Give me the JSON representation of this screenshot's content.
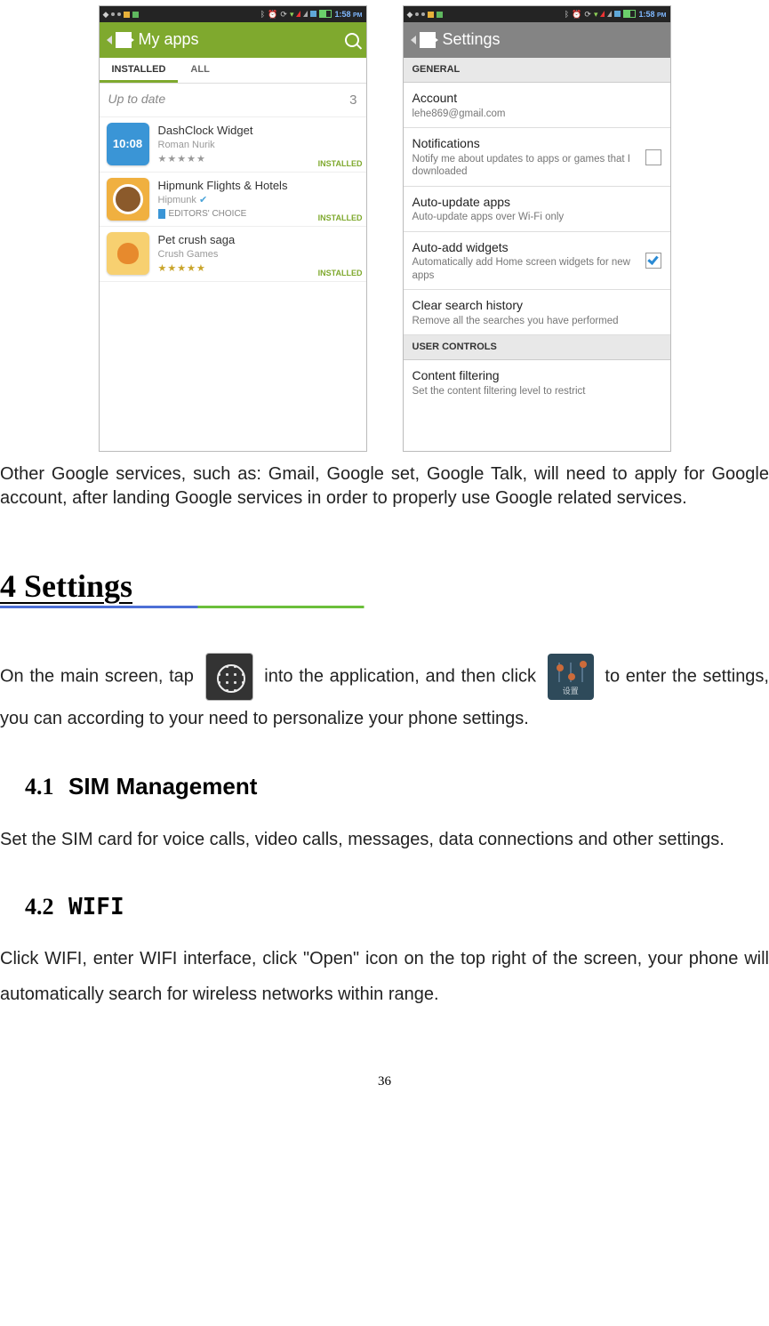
{
  "status": {
    "time": "1:58",
    "ampm": "PM"
  },
  "play": {
    "title": "My apps",
    "tabs": {
      "installed": "INSTALLED",
      "all": "ALL"
    },
    "uptodate": {
      "label": "Up to date",
      "count": "3"
    },
    "installed_badge": "INSTALLED",
    "apps": [
      {
        "name": "DashClock Widget",
        "dev": "Roman Nurik",
        "stars": "★★★★★",
        "iconTime": "10:08"
      },
      {
        "name": "Hipmunk Flights & Hotels",
        "dev": "Hipmunk",
        "editors": "EDITORS' CHOICE"
      },
      {
        "name": "Pet crush saga",
        "dev": "Crush Games",
        "stars": "★★★★★"
      }
    ]
  },
  "settings": {
    "title": "Settings",
    "section_general": "GENERAL",
    "items": {
      "account": {
        "title": "Account",
        "sub": "lehe869@gmail.com"
      },
      "notifications": {
        "title": "Notifications",
        "sub": "Notify me about updates to apps or games that I downloaded"
      },
      "autoupdate": {
        "title": "Auto-update apps",
        "sub": "Auto-update apps over Wi-Fi only"
      },
      "autoadd": {
        "title": "Auto-add widgets",
        "sub": "Automatically add Home screen widgets for new apps"
      },
      "clear": {
        "title": "Clear search history",
        "sub": "Remove all the searches you have performed"
      }
    },
    "section_user": "USER CONTROLS",
    "content_filtering": {
      "title": "Content filtering",
      "sub": "Set the content filtering level to restrict"
    },
    "icon_label": "设置"
  },
  "doc": {
    "para1": "Other Google services, such as: Gmail, Google set, Google Talk, will need to apply for Google account, after landing Google services in order to properly use Google related services.",
    "h4": "4   Settings",
    "para2a": "On the main screen, tap ",
    "para2b": " into the application, and then click ",
    "para2c": " to enter the settings, you can according to your need to personalize your phone settings.",
    "h41": {
      "num": "4.1",
      "title": "SIM Management"
    },
    "para3": "Set the SIM card for voice calls, video calls, messages, data connections and other settings.",
    "h42": {
      "num": "4.2",
      "title": "WIFI"
    },
    "para4": "Click WIFI, enter WIFI interface, click \"Open\" icon on the top right of the screen, your phone will automatically search for wireless networks within range.",
    "pagenum": "36"
  }
}
